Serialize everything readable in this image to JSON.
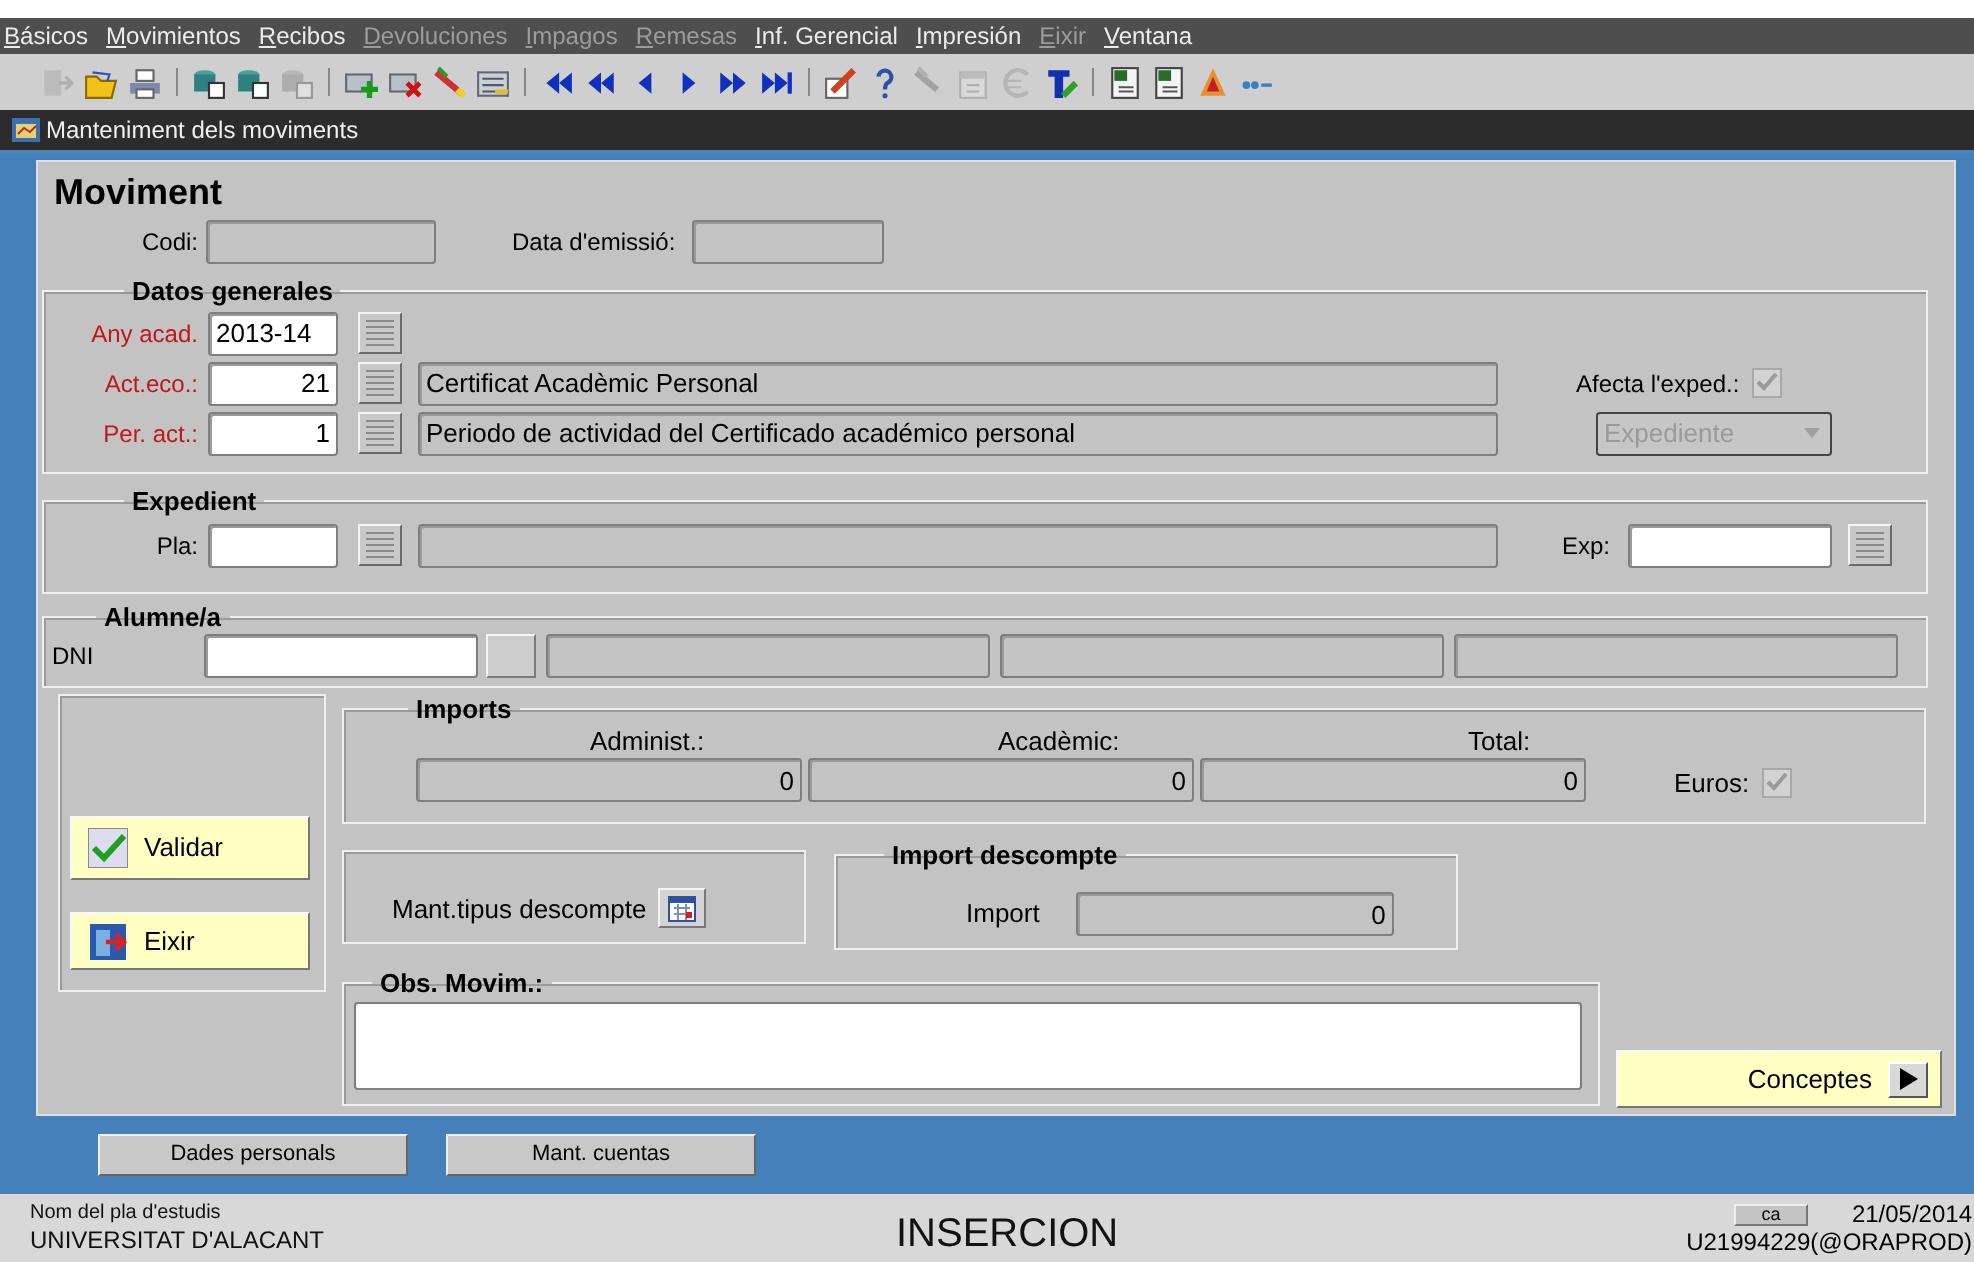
{
  "menu": [
    {
      "label": "Básicos",
      "disabled": false
    },
    {
      "label": "Movimientos",
      "disabled": false
    },
    {
      "label": "Recibos",
      "disabled": false
    },
    {
      "label": "Devoluciones",
      "disabled": true
    },
    {
      "label": "Impagos",
      "disabled": true
    },
    {
      "label": "Remesas",
      "disabled": true
    },
    {
      "label": "Inf. Gerencial",
      "disabled": false
    },
    {
      "label": "Impresión",
      "disabled": false
    },
    {
      "label": "Eixir",
      "disabled": true
    },
    {
      "label": "Ventana",
      "disabled": false
    }
  ],
  "toolbar": [
    {
      "kind": "exit",
      "disabled": true
    },
    {
      "kind": "save",
      "disabled": false
    },
    {
      "kind": "print",
      "disabled": false
    },
    {
      "kind": "separator"
    },
    {
      "kind": "query",
      "disabled": false
    },
    {
      "kind": "query",
      "disabled": false
    },
    {
      "kind": "query",
      "disabled": true
    },
    {
      "kind": "separator"
    },
    {
      "kind": "insert",
      "disabled": false
    },
    {
      "kind": "delete",
      "disabled": false
    },
    {
      "kind": "wand",
      "disabled": false
    },
    {
      "kind": "list",
      "disabled": false
    },
    {
      "kind": "separator"
    },
    {
      "kind": "first",
      "disabled": false
    },
    {
      "kind": "rewind",
      "disabled": false
    },
    {
      "kind": "previous",
      "disabled": false
    },
    {
      "kind": "next",
      "disabled": false
    },
    {
      "kind": "forward",
      "disabled": false
    },
    {
      "kind": "last",
      "disabled": false
    },
    {
      "kind": "separator"
    },
    {
      "kind": "edit",
      "disabled": false
    },
    {
      "kind": "help",
      "disabled": false
    },
    {
      "kind": "wand",
      "disabled": true
    },
    {
      "kind": "calendar",
      "disabled": true
    },
    {
      "kind": "euro",
      "disabled": true
    },
    {
      "kind": "text",
      "disabled": false
    },
    {
      "kind": "separator"
    },
    {
      "kind": "sheet",
      "disabled": false
    },
    {
      "kind": "sheet",
      "disabled": false
    },
    {
      "kind": "acrobat",
      "disabled": false
    },
    {
      "kind": "dots",
      "disabled": false
    }
  ],
  "window": {
    "title": "Manteniment dels moviments"
  },
  "form": {
    "heading": "Moviment",
    "code": {
      "label": "Codi:"
    },
    "issue_date": {
      "label": "Data d'emissió:"
    },
    "general": {
      "title": "Datos generales",
      "fields": [
        {
          "kind": "text",
          "label": "Any acad.",
          "value": "2013-14",
          "required": true
        },
        {
          "kind": "lookup",
          "label": "Act.eco.:",
          "value": "21",
          "required": true,
          "description": "Certificat Acadèmic Personal"
        },
        {
          "kind": "lookup",
          "label": "Per. act.:",
          "value": "1",
          "required": true,
          "description": "Periodo de actividad del Certificado académico personal"
        }
      ],
      "affects": {
        "label": "Afecta l'exped.:",
        "checked": true,
        "disabled": true
      },
      "scope": {
        "value": "Expediente",
        "disabled": true
      }
    },
    "record": {
      "title": "Expedient",
      "plan": {
        "label": "Pla:"
      },
      "file": {
        "label": "Exp:"
      }
    },
    "student": {
      "title": "Alumne/a",
      "dni": {
        "label": "DNI"
      }
    },
    "amounts": {
      "title": "Imports",
      "fields": [
        {
          "label": "Administ.:",
          "value": "0"
        },
        {
          "label": "Acadèmic:",
          "value": "0"
        },
        {
          "label": "Total:",
          "value": "0"
        }
      ],
      "euros": {
        "label": "Euros:",
        "checked": true,
        "disabled": true
      }
    },
    "actions": [
      {
        "kind": "validate",
        "label": "Validar"
      },
      {
        "kind": "exit",
        "label": "Eixir"
      }
    ],
    "discount_types": {
      "label": "Mant.tipus descompte"
    },
    "discount": {
      "title": "Import descompte",
      "label": "Import",
      "value": "0"
    },
    "notes": {
      "title": "Obs. Movim.:"
    },
    "concepts": {
      "label": "Conceptes"
    }
  },
  "bottom_buttons": [
    "Dades personals",
    "Mant. cuentas"
  ],
  "status_bar": {
    "caption": "Nom del pla d'estudis",
    "university": "UNIVERSITAT D'ALACANT",
    "mode": "INSERCION",
    "language": "ca",
    "date": "21/05/2014",
    "user": "U21994229(@ORAPROD)"
  }
}
